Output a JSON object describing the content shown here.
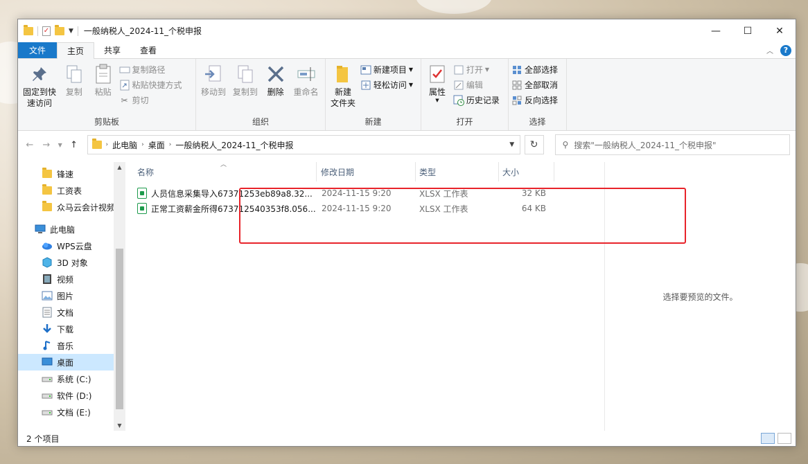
{
  "window": {
    "title": "一般纳税人_2024-11_个税申报",
    "controls": {
      "minimize": "—",
      "maximize": "☐",
      "close": "✕"
    }
  },
  "tabs": [
    {
      "label": "文件"
    },
    {
      "label": "主页"
    },
    {
      "label": "共享"
    },
    {
      "label": "查看"
    }
  ],
  "ribbon": {
    "clipboard": {
      "pin_label_1": "固定到快",
      "pin_label_2": "速访问",
      "copy": "复制",
      "paste": "粘贴",
      "copy_path": "复制路径",
      "paste_shortcut": "粘贴快捷方式",
      "cut": "剪切",
      "group": "剪贴板"
    },
    "organize": {
      "move_to": "移动到",
      "copy_to": "复制到",
      "delete": "删除",
      "rename": "重命名",
      "group": "组织"
    },
    "new": {
      "new_folder_1": "新建",
      "new_folder_2": "文件夹",
      "new_item": "新建项目",
      "easy_access": "轻松访问",
      "group": "新建"
    },
    "open": {
      "properties": "属性",
      "open": "打开",
      "edit": "编辑",
      "history": "历史记录",
      "group": "打开"
    },
    "select": {
      "select_all": "全部选择",
      "select_none": "全部取消",
      "invert": "反向选择",
      "group": "选择"
    }
  },
  "address": {
    "crumbs": [
      "此电脑",
      "桌面",
      "一般纳税人_2024-11_个税申报"
    ],
    "search_placeholder": "搜索\"一般纳税人_2024-11_个税申报\""
  },
  "nav": {
    "items": [
      {
        "label": "锋速",
        "icon": "folder-icon"
      },
      {
        "label": "工资表",
        "icon": "folder-icon"
      },
      {
        "label": "众马云会计视频",
        "icon": "folder-icon"
      },
      {
        "label": "此电脑",
        "icon": "computer-icon"
      },
      {
        "label": "WPS云盘",
        "icon": "cloud-icon"
      },
      {
        "label": "3D 对象",
        "icon": "cube-icon"
      },
      {
        "label": "视频",
        "icon": "video-icon"
      },
      {
        "label": "图片",
        "icon": "picture-icon"
      },
      {
        "label": "文档",
        "icon": "document-icon"
      },
      {
        "label": "下载",
        "icon": "download-icon"
      },
      {
        "label": "音乐",
        "icon": "music-icon"
      },
      {
        "label": "桌面",
        "icon": "desktop-icon"
      },
      {
        "label": "系统 (C:)",
        "icon": "drive-icon"
      },
      {
        "label": "软件 (D:)",
        "icon": "drive-icon"
      },
      {
        "label": "文档 (E:)",
        "icon": "drive-icon"
      }
    ],
    "selected": "桌面"
  },
  "columns": {
    "name": "名称",
    "date": "修改日期",
    "type": "类型",
    "size": "大小"
  },
  "files": [
    {
      "name": "人员信息采集导入67371253eb89a8.32...",
      "date": "2024-11-15 9:20",
      "type": "XLSX 工作表",
      "size": "32 KB"
    },
    {
      "name": "正常工资薪金所得673712540353f8.056...",
      "date": "2024-11-15 9:20",
      "type": "XLSX 工作表",
      "size": "64 KB"
    }
  ],
  "preview_text": "选择要预览的文件。",
  "status": {
    "count": "2 个项目"
  },
  "colors": {
    "accent": "#1979ca",
    "highlight_box": "#e8232a",
    "selection": "#cce8ff"
  }
}
